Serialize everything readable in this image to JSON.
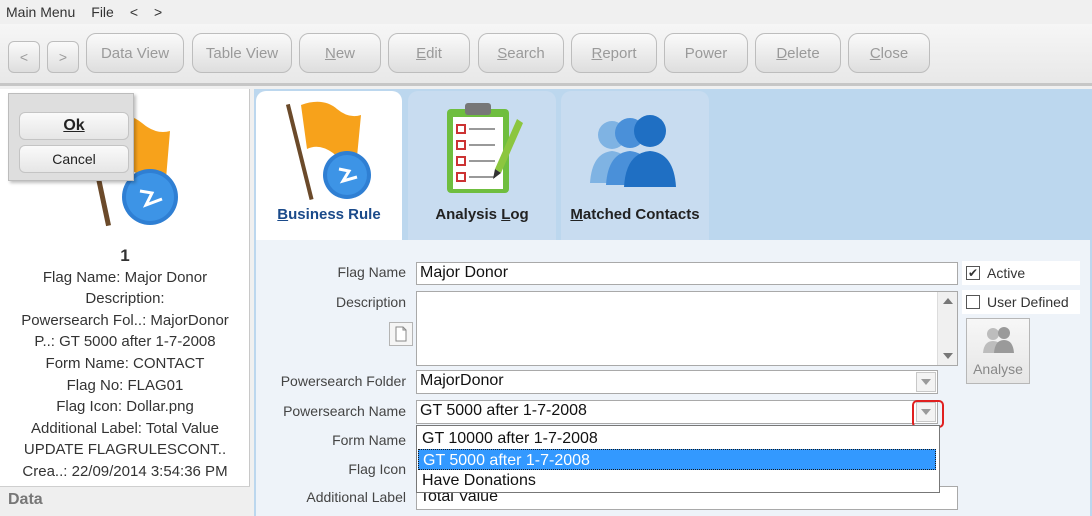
{
  "menubar": {
    "main_menu": "Main Menu",
    "file": "File",
    "back": "<",
    "forward": ">"
  },
  "toolbar": {
    "back": "<",
    "forward": ">",
    "data_view": "Data View",
    "table_view": "Table View",
    "new_mn": "N",
    "new_rest": "ew",
    "edit_mn": "E",
    "edit_rest": "dit",
    "search_mn": "S",
    "search_rest": "earch",
    "report_mn": "R",
    "report_rest": "eport",
    "power": "Power",
    "delete_mn": "D",
    "delete_rest": "elete",
    "close_mn": "C",
    "close_rest": "lose"
  },
  "popup": {
    "ok": "Ok",
    "cancel": "Cancel"
  },
  "info": {
    "number": "1",
    "flag_name": "Flag Name: Major Donor",
    "description": "Description:",
    "powersearch_folder": "Powersearch Fol..: MajorDonor",
    "powersearch_name": "P..: GT 5000 after 1-7-2008",
    "form_name": "Form Name: CONTACT",
    "flag_no": "Flag No: FLAG01",
    "flag_icon": "Flag Icon: Dollar.png",
    "additional_label": "Additional Label: Total Value",
    "update": "UPDATE FLAGRULESCONT..",
    "created": "Crea..: 22/09/2014 3:54:36 PM"
  },
  "databar": {
    "label": "Data"
  },
  "tabs": {
    "business_rule_mn": "B",
    "business_rule_rest": "usiness Rule",
    "analysis_log_pre": "Analysis ",
    "analysis_log_mn": "L",
    "analysis_log_post": "og",
    "matched_contacts_mn": "M",
    "matched_contacts_rest": "atched Contacts"
  },
  "form": {
    "flag_name_label": "Flag Name",
    "flag_name_value": "Major Donor",
    "description_label": "Description",
    "powersearch_folder_label": "Powersearch Folder",
    "powersearch_folder_value": "MajorDonor",
    "powersearch_name_label": "Powersearch Name",
    "powersearch_name_value": "GT 5000 after 1-7-2008",
    "form_name_label": "Form Name",
    "flag_icon_label": "Flag Icon",
    "additional_label_label": "Additional Label",
    "additional_label_value": "Total Value",
    "active_label": "Active",
    "active_checked": true,
    "user_defined_label": "User Defined",
    "user_defined_checked": false,
    "analyse_label": "Analyse"
  },
  "dropdown": {
    "options": [
      "GT 10000 after 1-7-2008",
      "GT 5000 after 1-7-2008",
      "Have Donations"
    ],
    "selected_index": 1
  },
  "colors": {
    "accent": "#3399ff",
    "highlight_ring": "#e02020",
    "panel_blue": "#bcd7ee"
  }
}
